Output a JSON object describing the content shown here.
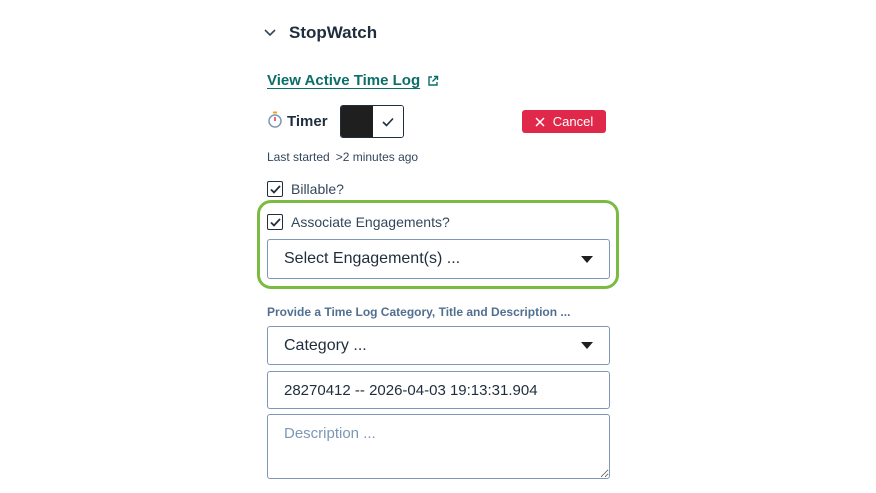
{
  "section": {
    "title": "StopWatch"
  },
  "links": {
    "view_log": "View Active Time Log"
  },
  "timer": {
    "label": "Timer",
    "icon": "stopwatch-icon",
    "toggle_on": true,
    "cancel_label": "Cancel"
  },
  "status": {
    "last_started_label": "Last started",
    "last_started_value": ">2 minutes ago"
  },
  "options": {
    "billable_label": "Billable?",
    "billable_checked": true,
    "associate_label": "Associate Engagements?",
    "associate_checked": true
  },
  "engagement": {
    "selected": "Select Engagement(s) ..."
  },
  "time_log": {
    "heading": "Provide a Time Log Category, Title and Description ...",
    "category_selected": "Category ...",
    "title_value": "28270412 -- 2026-04-03 19:13:31.904",
    "description_placeholder": "Description ..."
  },
  "colors": {
    "link": "#0b6e69",
    "cancel_bg": "#e0294a",
    "highlight": "#7cbb43",
    "toggle_dark": "#1f1f1f"
  }
}
